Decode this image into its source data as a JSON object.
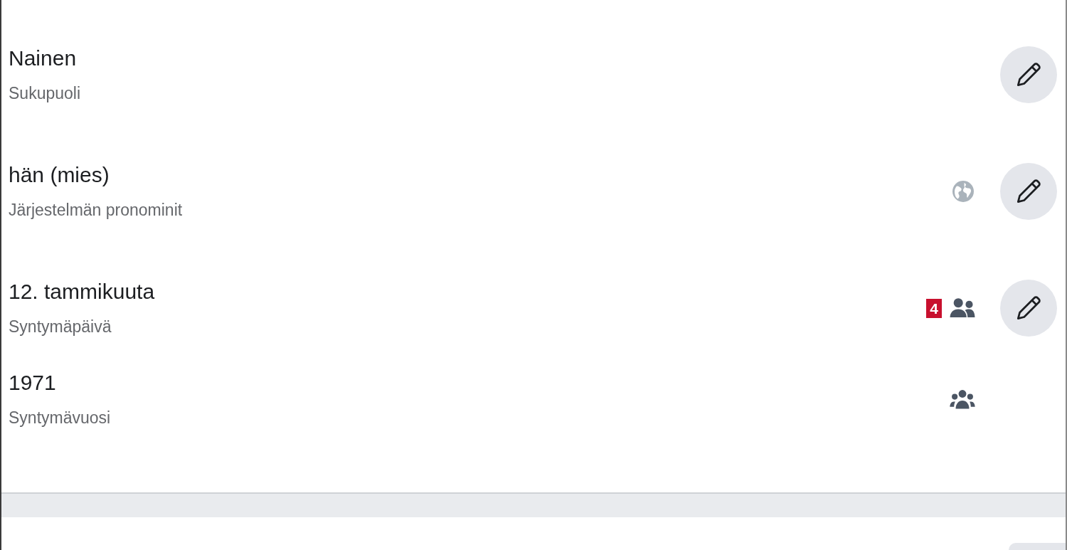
{
  "fields": [
    {
      "value": "Nainen",
      "label": "Sukupuoli",
      "editable": true
    },
    {
      "value": "hän (mies)",
      "label": "Järjestelmän pronominit",
      "kind": "public",
      "editable": true
    },
    {
      "value": "12. tammikuuta",
      "label": "Syntymäpäivä",
      "kind": "friends",
      "badge": "4",
      "editable": true
    },
    {
      "value": "1971",
      "label": "Syntymävuosi",
      "kind": "group",
      "editable": false
    }
  ]
}
